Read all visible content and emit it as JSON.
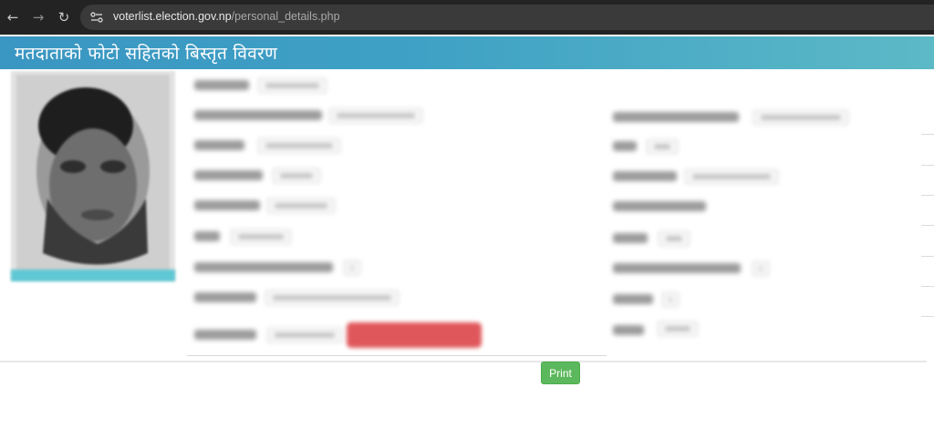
{
  "browser": {
    "url_domain": "voterlist.election.gov.np",
    "url_path": "/personal_details.php",
    "back_icon": "←",
    "forward_icon": "→",
    "reload_icon": "↻"
  },
  "page": {
    "title": "मतदाताको फोटो सहितको बिस्तृत विवरण",
    "print_label": "Print"
  },
  "colors": {
    "banner": "#3fa1c5",
    "print_button": "#5cb85c",
    "redacted_button": "#e0575b"
  }
}
